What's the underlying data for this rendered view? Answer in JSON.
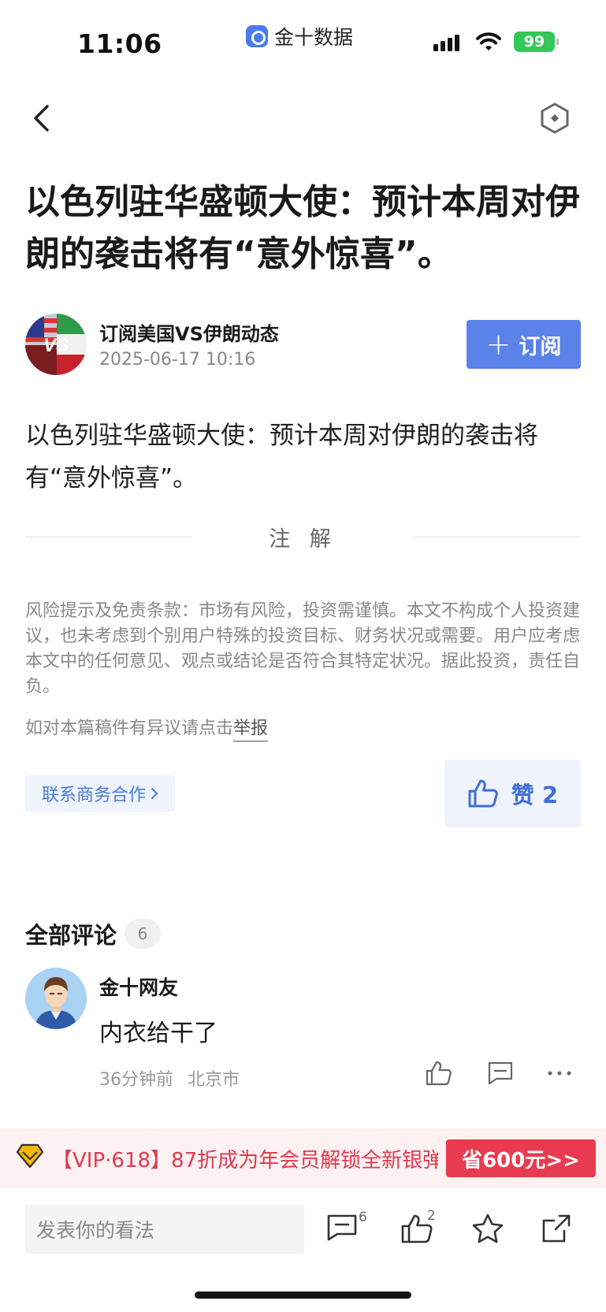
{
  "status_bar": {
    "time": "11:06",
    "app_name": "金十数据",
    "battery": "99",
    "icons": [
      "app-badge-icon",
      "cellular-signal-icon",
      "wifi-icon",
      "battery-charging-icon"
    ]
  },
  "nav": {
    "back_icon": "chevron-left-icon",
    "share_icon": "hexagon-share-icon"
  },
  "article": {
    "title": "以色列驻华盛顿大使：预计本周对伊朗的袭击将有“意外惊喜”。",
    "author": {
      "name": "订阅美国VS伊朗动态",
      "date": "2025-06-17 10:16",
      "avatar_text": "VS"
    },
    "subscribe_label": "订阅",
    "body": "以色列驻华盛顿大使：预计本周对伊朗的袭击将有“意外惊喜”。",
    "note_label": "注 解",
    "disclaimer": "风险提示及免责条款：市场有风险，投资需谨慎。本文不构成个人投资建议，也未考虑到个别用户特殊的投资目标、财务状况或需要。用户应考虑本文中的任何意见、观点或结论是否符合其特定状况。据此投资，责任自负。",
    "report_prefix": "如对本篇稿件有异议请点击",
    "report_link": "举报",
    "business_label": "联系商务合作",
    "like_label": "赞 2"
  },
  "comments": {
    "title": "全部评论",
    "count": "6",
    "items": [
      {
        "user": "金十网友",
        "text": "内衣给干了",
        "time": "36分钟前",
        "location": "北京市"
      }
    ]
  },
  "promo": {
    "text": "【VIP·618】87折成为年会员解锁全新银弹",
    "button": "省600元>>"
  },
  "bottom_bar": {
    "input_placeholder": "发表你的看法",
    "comment_count": "6",
    "like_count": "2"
  },
  "colors": {
    "accent": "#5b82e8",
    "like_blue": "#3f6ed8",
    "promo_red": "#e83b4f",
    "promo_bg": "#fdf1f2",
    "battery_green": "#34c759"
  }
}
